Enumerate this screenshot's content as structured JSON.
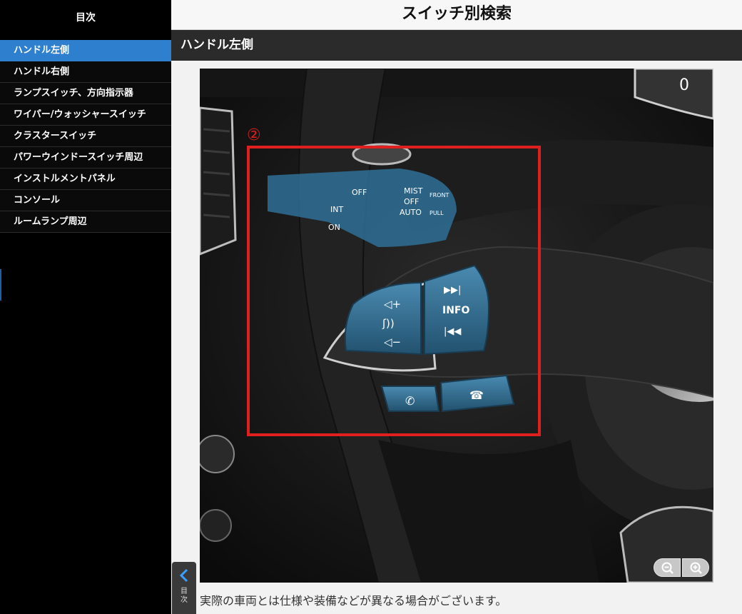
{
  "sidebar": {
    "title": "目次",
    "items": [
      {
        "label": "ハンドル左側",
        "active": true
      },
      {
        "label": "ハンドル右側"
      },
      {
        "label": "ランプスイッチ、方向指示器"
      },
      {
        "label": "ワイパー/ウォッシャースイッチ"
      },
      {
        "label": "クラスタースイッチ"
      },
      {
        "label": "パワーウインドースイッチ周辺"
      },
      {
        "label": "インストルメントパネル"
      },
      {
        "label": "コンソール"
      },
      {
        "label": "ルームランプ周辺"
      }
    ]
  },
  "header": {
    "title": "スイッチ別検索"
  },
  "section": {
    "title": "ハンドル左側"
  },
  "figure": {
    "callout_number": "②",
    "highlight_color": "#e0201e",
    "switch_color": "#2f6f95",
    "lever_labels": [
      "OFF",
      "INT",
      "ON",
      "MIST",
      "OFF",
      "AUTO",
      "FRONT",
      "PULL"
    ],
    "button_labels": [
      "INFO"
    ],
    "gauge_digit": "0"
  },
  "zoom": {
    "out_icon": "zoom-out-icon",
    "in_icon": "zoom-in-icon"
  },
  "caption": "実際の車両とは仕様や装備などが異なる場合がございます。",
  "toc_toggle": {
    "label": "目次",
    "icon": "chevron-left-icon"
  }
}
